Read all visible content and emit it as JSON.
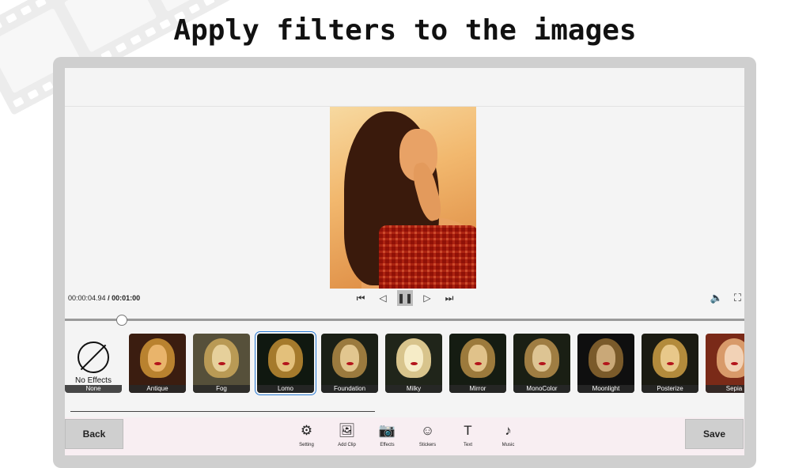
{
  "heading": "Apply filters to the images",
  "player": {
    "current_time": "00:00:04.94",
    "separator": "/",
    "total_time": "00:01:00"
  },
  "controls": {
    "skip_start_icon": "⏮",
    "prev_frame_icon": "◁",
    "pause_icon": "❚❚",
    "next_frame_icon": "▷",
    "skip_end_icon": "⏭",
    "volume_icon": "🔈",
    "fullscreen_icon": "⛶"
  },
  "effects": {
    "none_label": "None",
    "none_caption": "No Effects",
    "selected": "Lomo",
    "items": [
      {
        "label": "Antique",
        "bg": "#3b1d10",
        "hair": "#b9822f",
        "face": "#e9b46b"
      },
      {
        "label": "Fog",
        "bg": "#56503a",
        "hair": "#b99a55",
        "face": "#e6d09b"
      },
      {
        "label": "Lomo",
        "bg": "#101810",
        "hair": "#a57a2c",
        "face": "#e3c07b"
      },
      {
        "label": "Foundation",
        "bg": "#1a1f16",
        "hair": "#9b7a3e",
        "face": "#e2c68f"
      },
      {
        "label": "Milky",
        "bg": "#20251a",
        "hair": "#d8c48c",
        "face": "#f6ecc7"
      },
      {
        "label": "Mirror",
        "bg": "#151c12",
        "hair": "#9c7a3c",
        "face": "#e0c28a"
      },
      {
        "label": "MonoColor",
        "bg": "#1a1f14",
        "hair": "#9f7d42",
        "face": "#ddc493"
      },
      {
        "label": "Moonlight",
        "bg": "#0f0f0f",
        "hair": "#7a5a2a",
        "face": "#c9a878"
      },
      {
        "label": "Posterize",
        "bg": "#1b1b12",
        "hair": "#b38b3c",
        "face": "#e8c88a"
      },
      {
        "label": "Sepia",
        "bg": "#7a2a18",
        "hair": "#d89a6a",
        "face": "#f2d2b6"
      }
    ]
  },
  "buttons": {
    "back": "Back",
    "save": "Save"
  },
  "tools": [
    {
      "label": "Setting",
      "icon": "⚙",
      "name": "settings-icon"
    },
    {
      "label": "Add Clip",
      "icon": "🖼",
      "name": "add-clip-icon"
    },
    {
      "label": "Effects",
      "icon": "📷",
      "name": "effects-icon"
    },
    {
      "label": "Stickers",
      "icon": "☺",
      "name": "sticker-icon"
    },
    {
      "label": "Text",
      "icon": "T",
      "name": "text-icon"
    },
    {
      "label": "Music",
      "icon": "♪",
      "name": "music-icon"
    }
  ]
}
